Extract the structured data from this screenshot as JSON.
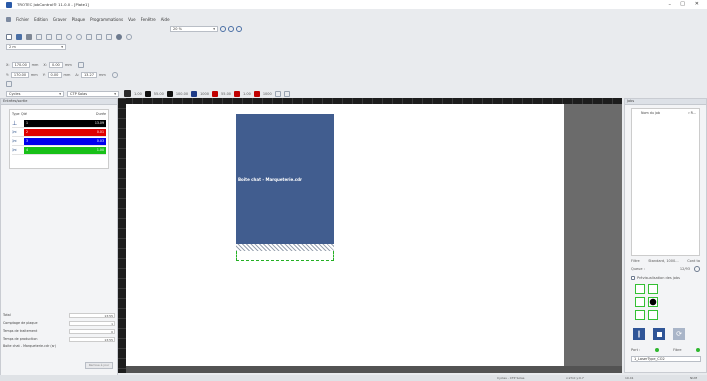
{
  "app": {
    "title": "TROTEC JobControl® 11.0.0 - [Plate1]"
  },
  "menu": [
    "Fichier",
    "Edition",
    "Graver",
    "Plaque",
    "Programmations",
    "Vue",
    "Fenêtre",
    "Aide"
  ],
  "zoom": {
    "value": "20 %"
  },
  "toolbar": {
    "size_value": "2 m"
  },
  "coords": {
    "x_label": "X:",
    "x_value": "170.00",
    "x_unit": "mm",
    "x_dx_label": "X:",
    "x_dx_value": "0.00",
    "x_dx_unit": "mm",
    "y_label": "Y:",
    "y_value": "170.00",
    "y_unit": "mm",
    "y_dy_label": "Y:",
    "y_dy_value": "0.00",
    "y_dy_unit": "mm",
    "angle_label": "Δ:",
    "angle_value": "13.27",
    "angle_unit": "mm"
  },
  "mode": {
    "select_value": "Cycles",
    "material_value": "CTP Solas"
  },
  "lasertools": [
    {
      "value": "1.00",
      "color": "#000000"
    },
    {
      "value": "55.00",
      "color": "#000000"
    },
    {
      "value": "100.00",
      "color": "#1f3c88"
    },
    {
      "value": "1000",
      "color": "#c00000"
    },
    {
      "value": "55.00",
      "color": "#c00000"
    },
    {
      "value": "1.00",
      "color": "#c00000"
    },
    {
      "value": "1000",
      "color": "#c00000"
    }
  ],
  "left_panel": {
    "title": "Entrées/sortie",
    "headers": {
      "type": "Type",
      "qty": "Qté",
      "duration": "Durée"
    },
    "rows": [
      {
        "num": "1",
        "duration": "13.09",
        "color": "#000000"
      },
      {
        "num": "2",
        "duration": "0.01",
        "color": "#e00000"
      },
      {
        "num": "3",
        "duration": "0.03",
        "color": "#0000ee"
      },
      {
        "num": "4",
        "duration": "1.00",
        "color": "#18c018"
      }
    ],
    "stats": [
      {
        "label": "Total",
        "value": "13:55"
      },
      {
        "label": "Comptage de plaque",
        "value": "1"
      },
      {
        "label": "Temps de traitement",
        "value": "0"
      },
      {
        "label": "Temps de production",
        "value": "13:55"
      }
    ],
    "job_file": "Boite chat - Marqueterie.cdr (sr)",
    "reset_label": "Remise à jour"
  },
  "canvas": {
    "job_label": "Boite chat - Marqueterie.cdr"
  },
  "right_panel": {
    "title": "Jobs",
    "col_name": "Nom du job",
    "col_extra": "▿ R...",
    "filter_label": "Filtre",
    "filter_value": "Standard, 1000...",
    "filter_btn": "Cont ta",
    "queue_label": "Queue :",
    "queue_value": "12/93",
    "preview_label": "Prévisualisation des jobs",
    "port_label": "Port :",
    "file_label": "Fibre",
    "device_value": "1_LaserType_CO2"
  },
  "status": {
    "mode": "Cycles - CTP Solas",
    "coord": "x:23.0 y:0.7",
    "zoom": "10.41",
    "num": "NUM"
  }
}
